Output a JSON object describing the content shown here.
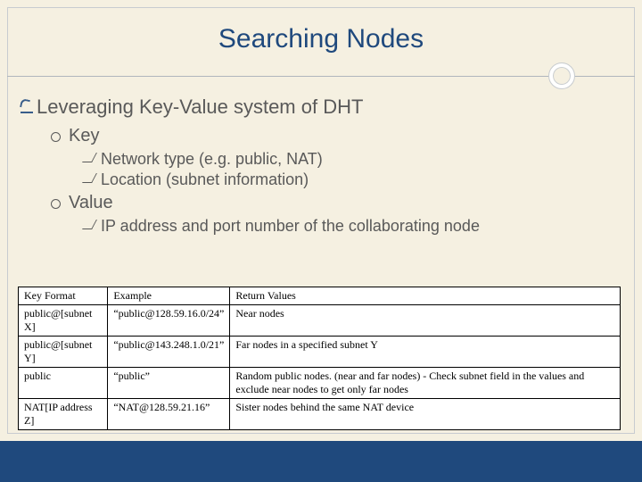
{
  "title": "Searching Nodes",
  "bullets": {
    "l1": "Leveraging Key-Value system of DHT",
    "key": {
      "label": "Key",
      "items": [
        "Network type (e.g. public, NAT)",
        "Location (subnet information)"
      ]
    },
    "value": {
      "label": "Value",
      "items": [
        "IP address and port number of the collaborating node"
      ]
    }
  },
  "table": {
    "headers": [
      "Key Format",
      "Example",
      "Return Values"
    ],
    "rows": [
      [
        "public@[subnet X]",
        "“public@128.59.16.0/24”",
        "Near nodes"
      ],
      [
        "public@[subnet Y]",
        "“public@143.248.1.0/21”",
        "Far nodes in a specified subnet Y"
      ],
      [
        "public",
        "“public”",
        "Random public nodes. (near and far nodes) - Check subnet field in the values and exclude near nodes to get only far nodes"
      ],
      [
        "NAT[IP address Z]",
        "“NAT@128.59.21.16”",
        "Sister nodes behind the same NAT device"
      ]
    ]
  },
  "colors": {
    "accent": "#1f497d",
    "background": "#f5f0e1",
    "text": "#595959"
  }
}
